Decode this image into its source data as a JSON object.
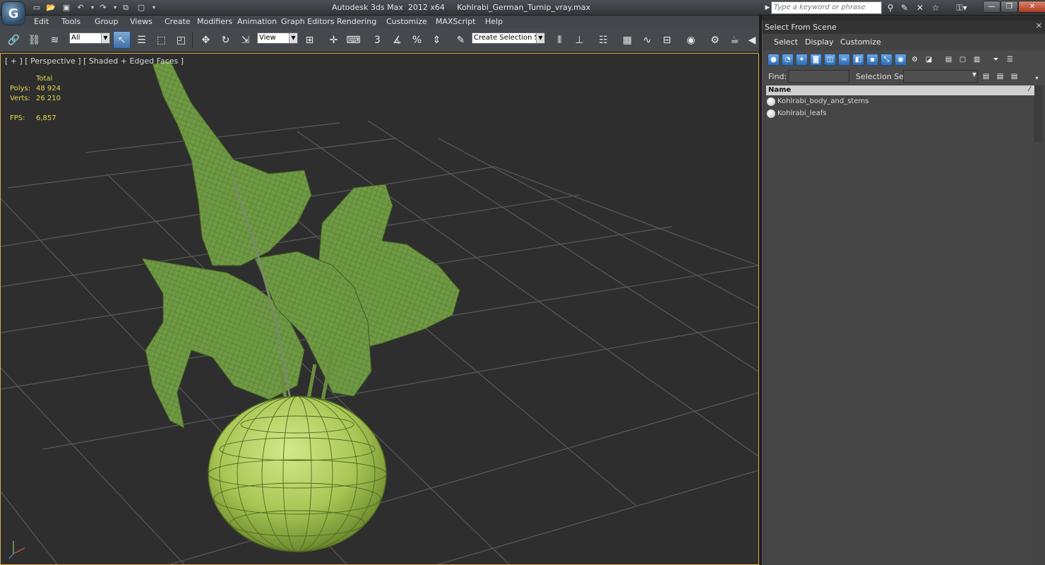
{
  "window": {
    "title": "Autodesk 3ds Max  2012 x64     Kohlrabi_German_Turnip_vray.max",
    "search_placeholder": "Type a keyword or phrase"
  },
  "menu": [
    "Edit",
    "Tools",
    "Group",
    "Views",
    "Create",
    "Modifiers",
    "Animation",
    "Graph Editors",
    "Rendering",
    "Customize",
    "MAXScript",
    "Help"
  ],
  "toolbar": {
    "filter_value": "All",
    "coord_value": "View",
    "selection_set_value": "Create Selection Se"
  },
  "viewport": {
    "label": "[ + ] [ Perspective ] [ Shaded + Edged Faces ]",
    "stats": {
      "total_label": "Total",
      "polys_label": "Polys:",
      "polys_value": "48 924",
      "verts_label": "Verts:",
      "verts_value": "26 210",
      "fps_label": "FPS:",
      "fps_value": "6,857"
    },
    "border_color": "#d8b04a",
    "object_color": "#9bbf52"
  },
  "select_from_scene": {
    "title": "Select From Scene",
    "menu": [
      "Select",
      "Display",
      "Customize"
    ],
    "find_label": "Find:",
    "selection_set_label": "Selection Set:",
    "column_name": "Name",
    "objects": [
      "Kohlrabi_body_and_stems",
      "Kohlrabi_leafs"
    ]
  }
}
